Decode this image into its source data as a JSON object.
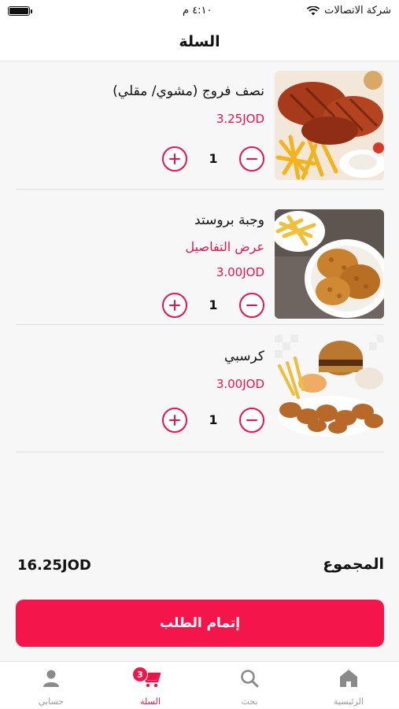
{
  "status_bar": {
    "carrier": "شركة الاتصالات",
    "time": "٤:١٠ م",
    "wifi_icon": "wifi-icon",
    "battery_icon": "battery-icon",
    "battery_level": 1.0
  },
  "header": {
    "title": "السلة"
  },
  "cart": {
    "items": [
      {
        "name": "نصف فروج (مشوي/ مقلي)",
        "price": "3.25JOD",
        "quantity": "1",
        "image": "grilled-chicken-image"
      },
      {
        "name": "وجبة بروستد",
        "details_link": "عرض التفاصيل",
        "price": "3.00JOD",
        "quantity": "1",
        "image": "broasted-chicken-image"
      },
      {
        "name": "كرسبي",
        "price": "3.00JOD",
        "quantity": "1",
        "image": "crispy-meal-image"
      }
    ]
  },
  "summary": {
    "total_label": "المجموع",
    "total_value": "16.25JOD"
  },
  "checkout": {
    "label": "إتمام الطلب"
  },
  "tab_bar": {
    "home": {
      "label": "الرئيسية",
      "icon": "home-icon"
    },
    "search": {
      "label": "بحث",
      "icon": "search-icon"
    },
    "cart": {
      "label": "السلة",
      "icon": "cart-icon",
      "badge": "3"
    },
    "account": {
      "label": "حسابي",
      "icon": "user-icon"
    }
  },
  "colors": {
    "accent": "#f4164b",
    "price": "#e8134a",
    "background": "#f7f7f7"
  }
}
